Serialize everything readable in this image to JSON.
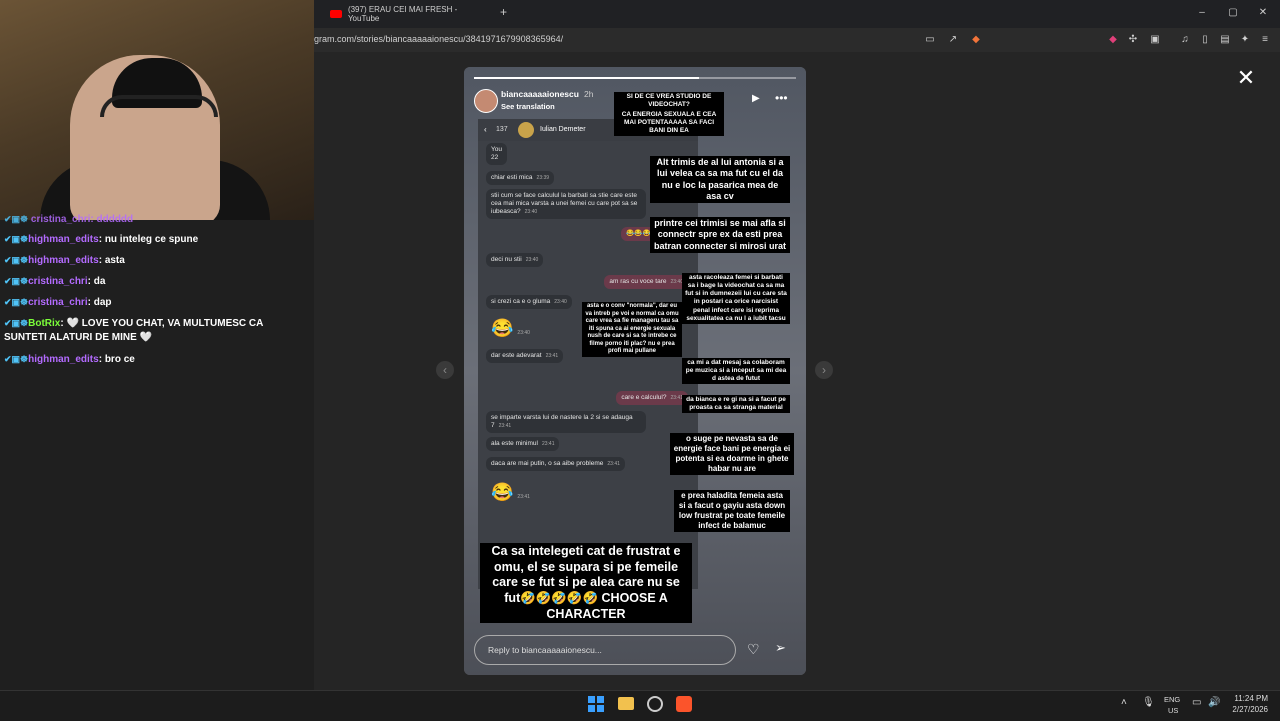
{
  "browser": {
    "tab_title": "(397) ERAU CEI MAI FRESH - YouTube",
    "url": "gram.com/stories/biancaaaaaionescu/3841971679908365964/",
    "add_tab": "+"
  },
  "chat": {
    "partial_line": "cristina_chri: dddddd",
    "lines": [
      {
        "user": "highman_edits",
        "color": "purple",
        "text": "nu inteleg ce spune"
      },
      {
        "user": "highman_edits",
        "color": "purple",
        "text": "asta"
      },
      {
        "user": "cristina_chri",
        "color": "purple",
        "text": "da"
      },
      {
        "user": "cristina_chri",
        "color": "purple",
        "text": "dap"
      },
      {
        "user": "BotRix",
        "color": "green",
        "text": "🤍 LOVE YOU CHAT, VA MULTUMESC CA SUNTETI ALATURI DE MINE 🤍"
      },
      {
        "user": "highman_edits",
        "color": "purple",
        "text": "bro ce"
      }
    ]
  },
  "story": {
    "username": "biancaaaaaionescu",
    "time": "2h",
    "see_translation": "See translation",
    "reply_placeholder": "Reply to biancaaaaaionescu...",
    "progress_fraction": 0.7,
    "phone": {
      "back_count": "137",
      "contact": "Iulian Demeter",
      "messages": [
        {
          "dir": "in",
          "text": "You\n22"
        },
        {
          "dir": "in",
          "text": "chiar esti mica",
          "time": "23:39"
        },
        {
          "dir": "in",
          "text": "stii cum se face calculul la barbati sa stie care este cea mai mica varsta a unei femei cu care pot sa se iubeasca?",
          "time": "23:40"
        },
        {
          "dir": "out",
          "text": "😂😂😂😂😂😂😂"
        },
        {
          "dir": "in",
          "text": "deci nu stii",
          "time": "23:40"
        },
        {
          "dir": "out",
          "text": "am ras cu voce tare",
          "time": "23:40"
        },
        {
          "dir": "in",
          "text": "si crezi ca e o gluma",
          "time": "23:40"
        },
        {
          "dir": "in",
          "text": "😂",
          "time": "23:40"
        },
        {
          "dir": "in",
          "text": "dar este adevarat",
          "time": "23:41"
        },
        {
          "dir": "out",
          "text": "care e calculul?",
          "time": "23:41"
        },
        {
          "dir": "in",
          "text": "se imparte varsta lui de nastere la 2 si se adauga 7",
          "time": "23:41"
        },
        {
          "dir": "in",
          "text": "ala este minimul",
          "time": "23:41"
        },
        {
          "dir": "in",
          "text": "daca are mai putin, o sa aibe probleme",
          "time": "23:41"
        },
        {
          "dir": "in",
          "text": "😂",
          "time": "23:41"
        }
      ]
    },
    "captions": {
      "c1": "SI DE CE VREA STUDIO DE VIDEOCHAT?",
      "c2": "CA ENERGIA SEXUALA E CEA MAI POTENTAAAAA SA FACI BANI DIN EA",
      "c3": "Alt trimis de al lui antonia si a lui velea ca sa ma fut cu el da nu e loc la pasarica mea de asa cv",
      "c4": "printre cei trimisi se mai afla si connectr spre ex da esti prea batran connecter si mirosi urat",
      "c5": "asta racoleaza femei si barbati sa i bage la videochat ca sa ma fut si in dumnezeii lui cu care sta in postari ca orice narcisist penal infect care isi reprima sexualitatea ca nu l a iubit tacsu",
      "c6": "asta e o conv \"normala\", dar eu va intreb pe voi e normal ca omu care vrea sa fie manageru tau sa iti spuna ca ai energie sexuala nush de care si sa te intrebe ce filme porno iti plac? nu e prea profi mai pullane",
      "c7": "ca mi a dat mesaj sa colaboram pe muzica si a inceput sa mi dea d astea de futut",
      "c8": "da bianca e re gi na si a facut pe proasta ca sa stranga material",
      "c9": "o suge pe nevasta sa de energie face bani pe energia ei potenta si ea doarme in ghete habar nu are",
      "c10": "e prea haladita femeia asta si a facut o gayiu asta down low frustrat pe toate femeile infect de balamuc",
      "c11": "Ca sa intelegeti cat de frustrat e omu, el se supara si pe femeile care se fut si pe alea care nu se fut🤣🤣🤣🤣🤣 CHOOSE A CHARACTER"
    }
  },
  "taskbar": {
    "lang_top": "ENG",
    "lang_bottom": "US",
    "time": "11:24 PM",
    "date": "2/27/2026"
  },
  "icons": [
    "close-icon",
    "play-icon",
    "more-icon",
    "heart-icon",
    "send-icon",
    "windows-start-icon",
    "file-explorer-icon",
    "brave-icon"
  ]
}
